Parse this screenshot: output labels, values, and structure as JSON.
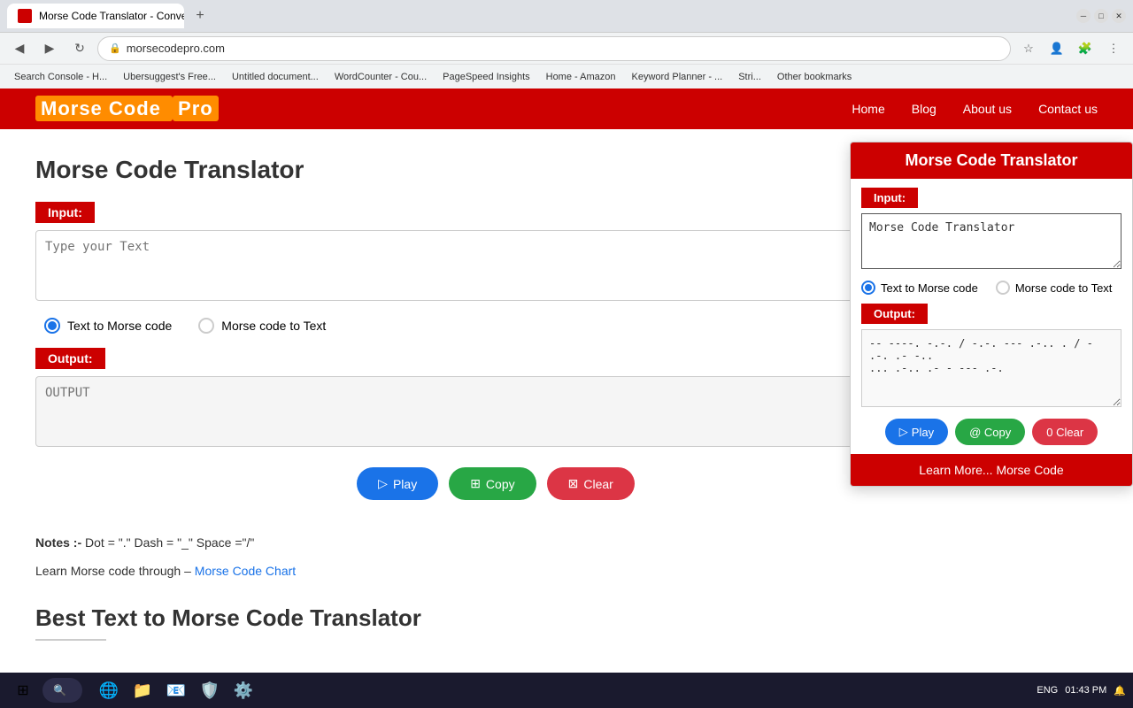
{
  "browser": {
    "tab_title": "Morse Code Translator - Conver...",
    "url": "morsecodepro.com",
    "new_tab_label": "+",
    "bookmarks": [
      "Search Console - H...",
      "Ubersuggest's Free...",
      "Untitled document...",
      "WordCounter - Cou...",
      "PageSpeed Insights",
      "Home - Amazon",
      "Keyword Planner - ...",
      "Stri...",
      "Other bookmarks"
    ]
  },
  "site": {
    "logo_text": "Morse Code ",
    "logo_pro": "Pro",
    "nav": {
      "home": "Home",
      "blog": "Blog",
      "about": "About us",
      "contact": "Contact us"
    }
  },
  "main": {
    "page_title": "Morse Code Translator",
    "input_label": "Input:",
    "input_placeholder": "Type your Text",
    "radio_text_to_morse": "Text to Morse code",
    "radio_morse_to_text": "Morse code to Text",
    "output_label": "Output:",
    "output_placeholder": "OUTPUT",
    "btn_play": "Play",
    "btn_copy": "Copy",
    "btn_clear": "Clear",
    "notes_label": "Notes :-",
    "notes_text": " Dot = \".\" Dash = \"_\" Space =\"/\"",
    "learn_link_text": "Learn Morse code through –",
    "morse_chart_link": "Morse Code Chart",
    "section_title_2": "Best Text to Morse Code Translator"
  },
  "popup": {
    "title": "Morse Code Translator",
    "input_label": "Input:",
    "input_value": "Morse Code Translator",
    "radio_text_to_morse": "Text to Morse code",
    "radio_morse_to_text": "Morse code to Text",
    "output_label": "Output:",
    "output_value": "-- ----. -.-. / -.-. --- .-.. . / - .-. .- -..\n... .-.. .- - --- .-.",
    "btn_play": "Play",
    "btn_copy": "@ Copy",
    "btn_clear": "0 Clear",
    "learn_btn": "Learn More... Morse Code"
  },
  "taskbar": {
    "time": "01:43 PM",
    "lang": "ENG"
  }
}
